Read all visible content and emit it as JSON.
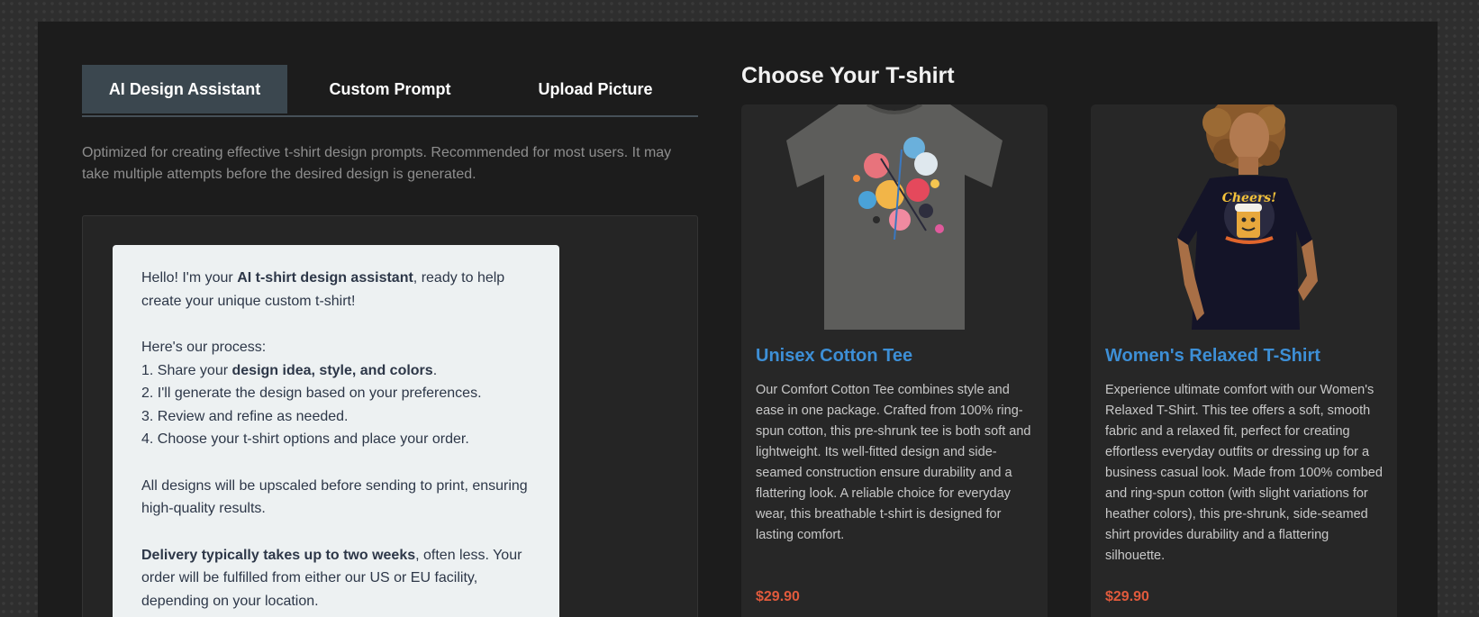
{
  "tabs": [
    {
      "label": "AI Design Assistant",
      "active": true
    },
    {
      "label": "Custom Prompt",
      "active": false
    },
    {
      "label": "Upload Picture",
      "active": false
    }
  ],
  "intro": "Optimized for creating effective t-shirt design prompts. Recommended for most users. It may take multiple attempts before the desired design is generated.",
  "chat": {
    "greet_pre": "Hello! I'm your ",
    "greet_bold": "AI t-shirt design assistant",
    "greet_post": ", ready to help create your unique custom t-shirt!",
    "process_title": "Here's our process:",
    "step1_pre": "1. Share your ",
    "step1_bold": "design idea, style, and colors",
    "step1_post": ".",
    "step2": "2. I'll generate the design based on your preferences.",
    "step3": "3. Review and refine as needed.",
    "step4": "4. Choose your t-shirt options and place your order.",
    "upscale": "All designs will be upscaled before sending to print, ensuring high-quality results.",
    "delivery_bold": "Delivery typically takes up to two weeks",
    "delivery_post": ", often less. Your order will be fulfilled from either our US or EU facility, depending on your location."
  },
  "products": {
    "title": "Choose Your T-shirt",
    "items": [
      {
        "name": "Unisex Cotton Tee",
        "description": "Our Comfort Cotton Tee combines style and ease in one package. Crafted from 100% ring-spun cotton, this pre-shrunk tee is both soft and lightweight. Its well-fitted design and side-seamed construction ensure durability and a flattering look. A reliable choice for everyday wear, this breathable t-shirt is designed for lasting comfort.",
        "price": "$29.90",
        "image_icon": "grey-tshirt-abstract-print-image"
      },
      {
        "name": "Women's Relaxed T-Shirt",
        "description": "Experience ultimate comfort with our Women's Relaxed T-Shirt. This tee offers a soft, smooth fabric and a relaxed fit, perfect for creating effortless everyday outfits or dressing up for a business casual look. Made from 100% combed and ring-spun cotton (with slight variations for heather colors), this pre-shrunk, side-seamed shirt provides durability and a flattering silhouette.",
        "price": "$29.90",
        "image_icon": "woman-navy-tshirt-image",
        "print_text": "Cheers!"
      }
    ]
  },
  "colors": {
    "accent_title": "#3d8fd6",
    "price": "#e05a3c",
    "active_tab": "#3b474f"
  }
}
